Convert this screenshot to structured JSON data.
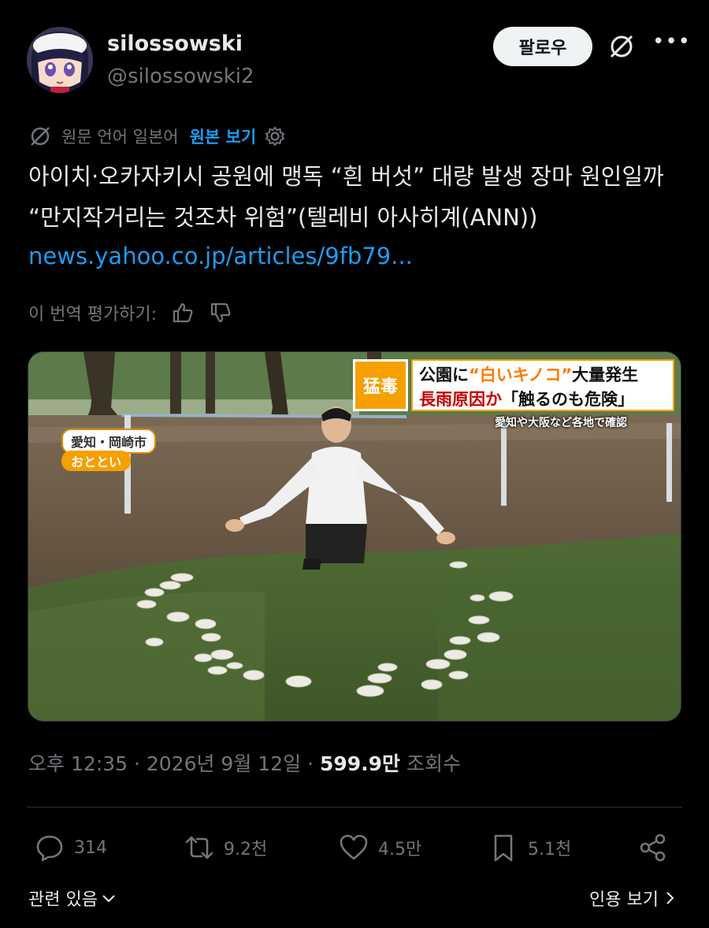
{
  "user": {
    "name": "silossowski",
    "handle": "@silossowski2",
    "follow_label": "팔로우"
  },
  "translation": {
    "source_label": "원문 언어 일본어",
    "show_original": "원본 보기"
  },
  "tweet": {
    "text": "아이치·오카자키시 공원에 맹독 “흰 버섯” 대량 발생 장마 원인일까 “만지작거리는 것조차 위험”(텔레비 아사히계(ANN))",
    "link": "news.yahoo.co.jp/articles/9fb79..."
  },
  "rating": {
    "label": "이 번역 평가하기:"
  },
  "media": {
    "badge": "猛毒",
    "caption_line1_pre": "公園に",
    "caption_line1_quote": "“白いキノコ”",
    "caption_line1_post": "大量発生",
    "caption_line2_red": "長雨原因か",
    "caption_line2_black": "「触るのも危険」",
    "caption_sub": "愛知や大阪など各地で確認",
    "location": "愛知・岡崎市",
    "date": "おととい"
  },
  "meta": {
    "time": "오후 12:35",
    "date": "2026년 9월 12일",
    "views_count": "599.9만",
    "views_label": "조회수"
  },
  "actions": {
    "replies": "314",
    "reposts": "9.2천",
    "likes": "4.5만",
    "bookmarks": "5.1천"
  },
  "footer": {
    "related": "관련 있음",
    "quotes": "인용 보기"
  },
  "colors": {
    "background": "#000000",
    "text": "#e7e9ea",
    "secondary": "#71767b",
    "accent": "#1d9bf0"
  }
}
